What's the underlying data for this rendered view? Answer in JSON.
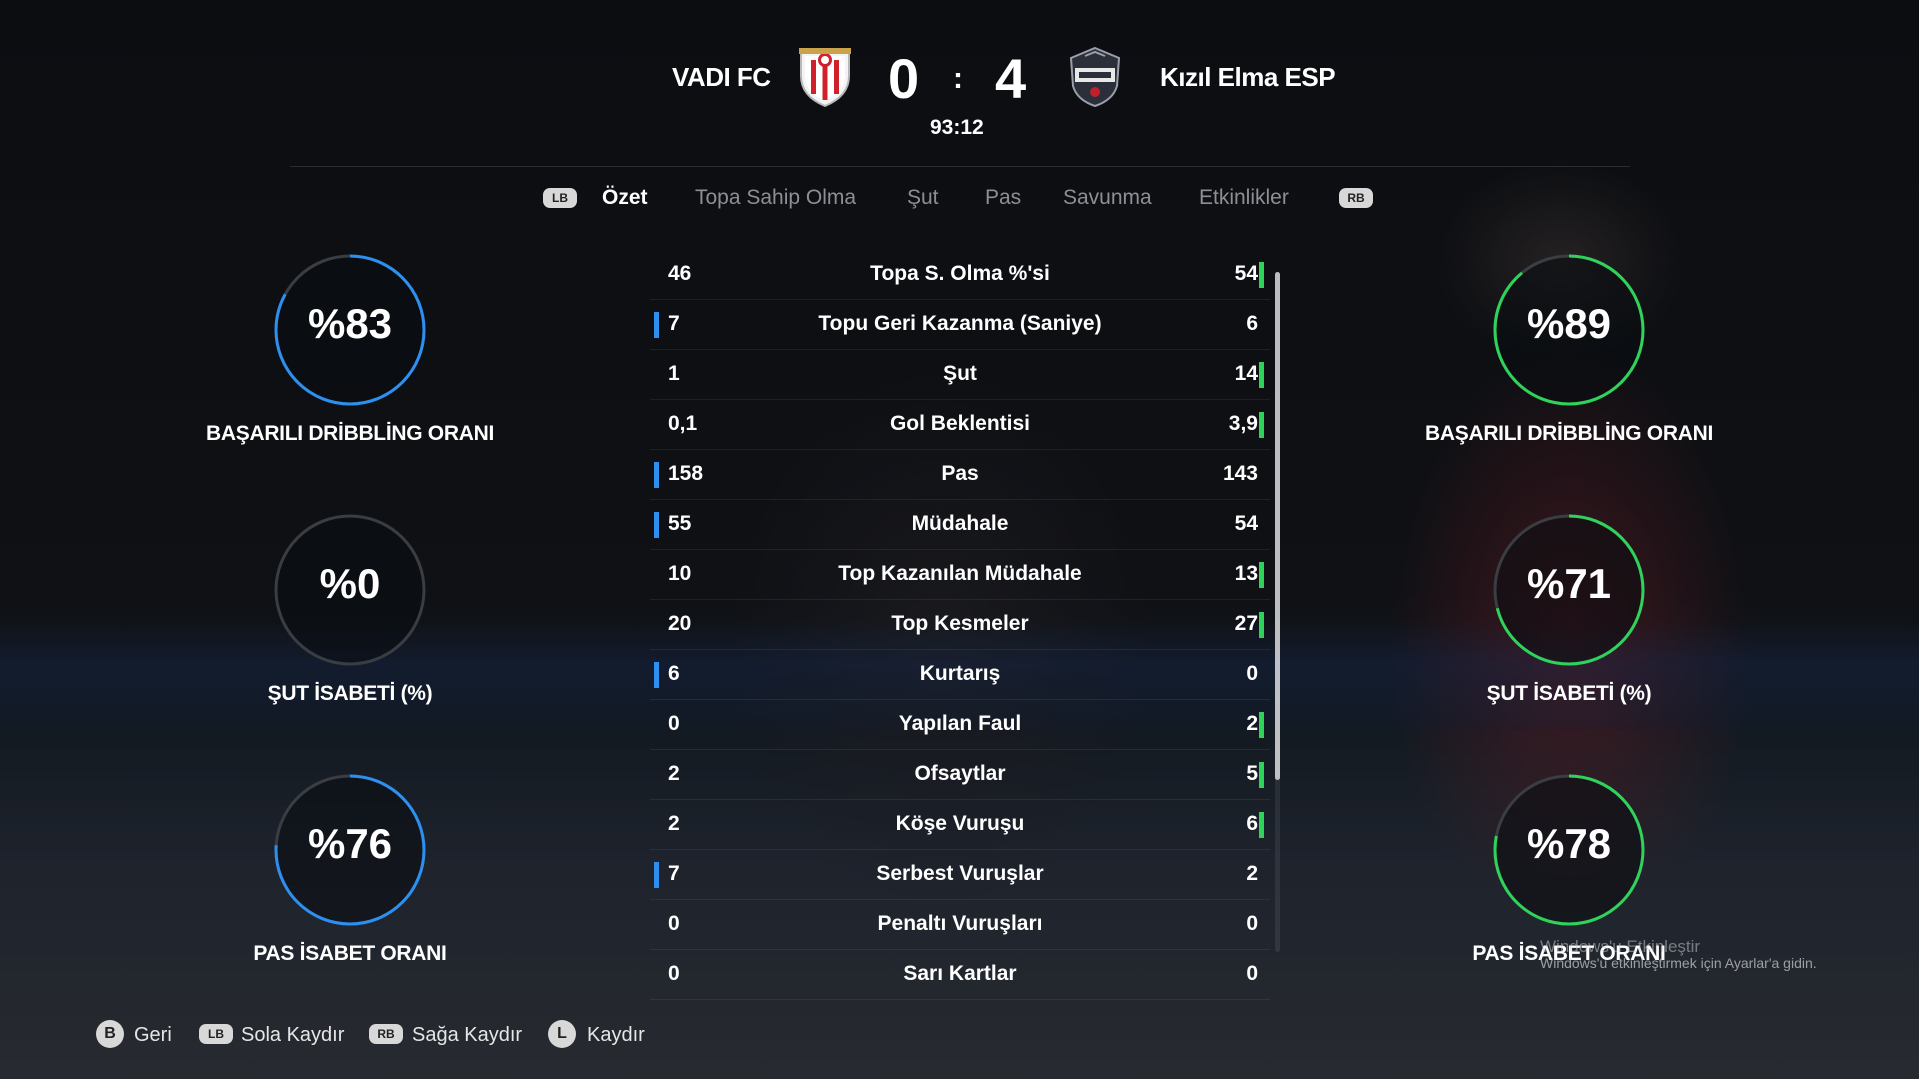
{
  "match": {
    "home_team": "VADI FC",
    "away_team": "Kızıl Elma ESP",
    "home_score": "0",
    "away_score": "4",
    "separator": ":",
    "clock": "93:12"
  },
  "tabs": {
    "left_bumper": "LB",
    "right_bumper": "RB",
    "items": [
      "Özet",
      "Topa Sahip Olma",
      "Şut",
      "Pas",
      "Savunma",
      "Etkinlikler"
    ],
    "active": "Özet"
  },
  "colors": {
    "home_accent": "#2d8ff0",
    "away_accent": "#2fd35a",
    "gauge_track": "#3a3d42"
  },
  "stats": [
    {
      "label": "Topa S. Olma %'si",
      "home": "46",
      "away": "54",
      "leader": "away"
    },
    {
      "label": "Topu Geri Kazanma (Saniye)",
      "home": "7",
      "away": "6",
      "leader": "home"
    },
    {
      "label": "Şut",
      "home": "1",
      "away": "14",
      "leader": "away"
    },
    {
      "label": "Gol Beklentisi",
      "home": "0,1",
      "away": "3,9",
      "leader": "away"
    },
    {
      "label": "Pas",
      "home": "158",
      "away": "143",
      "leader": "home"
    },
    {
      "label": "Müdahale",
      "home": "55",
      "away": "54",
      "leader": "home"
    },
    {
      "label": "Top Kazanılan Müdahale",
      "home": "10",
      "away": "13",
      "leader": "away"
    },
    {
      "label": "Top Kesmeler",
      "home": "20",
      "away": "27",
      "leader": "away"
    },
    {
      "label": "Kurtarış",
      "home": "6",
      "away": "0",
      "leader": "home"
    },
    {
      "label": "Yapılan Faul",
      "home": "0",
      "away": "2",
      "leader": "away"
    },
    {
      "label": "Ofsaytlar",
      "home": "2",
      "away": "5",
      "leader": "away"
    },
    {
      "label": "Köşe Vuruşu",
      "home": "2",
      "away": "6",
      "leader": "away"
    },
    {
      "label": "Serbest Vuruşlar",
      "home": "7",
      "away": "2",
      "leader": "home"
    },
    {
      "label": "Penaltı Vuruşları",
      "home": "0",
      "away": "0",
      "leader": "none"
    },
    {
      "label": "Sarı Kartlar",
      "home": "0",
      "away": "0",
      "leader": "none"
    }
  ],
  "gauges": {
    "home": [
      {
        "value_text": "%83",
        "value": 83,
        "label": "BAŞARILI DRİBBLİNG ORANI"
      },
      {
        "value_text": "%0",
        "value": 0,
        "label": "ŞUT İSABETİ (%)"
      },
      {
        "value_text": "%76",
        "value": 76,
        "label": "PAS İSABET ORANI"
      }
    ],
    "away": [
      {
        "value_text": "%89",
        "value": 89,
        "label": "BAŞARILI DRİBBLİNG ORANI"
      },
      {
        "value_text": "%71",
        "value": 71,
        "label": "ŞUT İSABETİ (%)"
      },
      {
        "value_text": "%78",
        "value": 78,
        "label": "PAS İSABET ORANI"
      }
    ]
  },
  "footer": {
    "back_key": "B",
    "back_label": "Geri",
    "left_key": "LB",
    "left_label": "Sola Kaydır",
    "right_key": "RB",
    "right_label": "Sağa Kaydır",
    "scroll_key": "L",
    "scroll_label": "Kaydır"
  },
  "watermark": {
    "title": "Windows'u Etkinleştir",
    "text": "Windows'u etkinleştirmek için Ayarlar'a gidin."
  }
}
